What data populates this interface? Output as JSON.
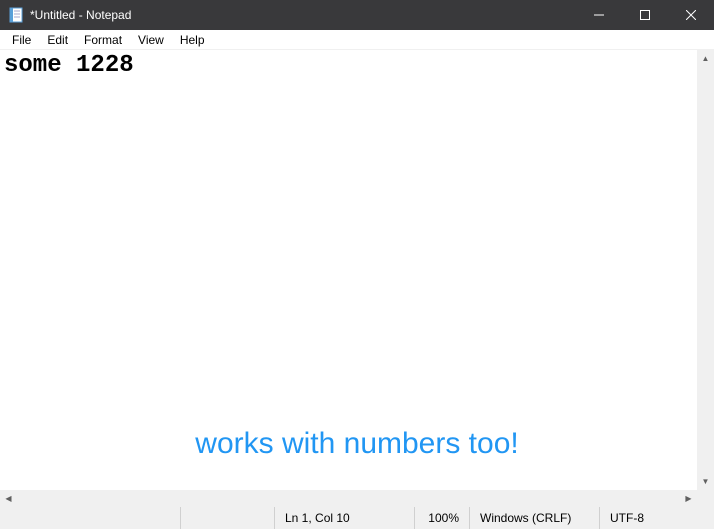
{
  "titlebar": {
    "title": "*Untitled - Notepad"
  },
  "menu": {
    "file": "File",
    "edit": "Edit",
    "format": "Format",
    "view": "View",
    "help": "Help"
  },
  "editor": {
    "content": "some 1228"
  },
  "status": {
    "position": "Ln 1, Col 10",
    "zoom": "100%",
    "line_ending": "Windows (CRLF)",
    "encoding": "UTF-8"
  },
  "annotation": {
    "text": "works with numbers too!"
  }
}
